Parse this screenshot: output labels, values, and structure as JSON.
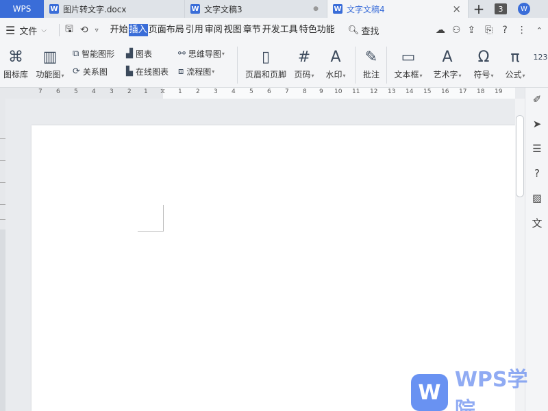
{
  "tabs": {
    "home": "WPS",
    "items": [
      {
        "title": "图片转文字.docx",
        "close": "×"
      },
      {
        "title": "文字文稿3",
        "close": "●"
      },
      {
        "title": "文字文稿4",
        "close": "×"
      }
    ],
    "count": "3"
  },
  "menubar": {
    "file": "文件",
    "tabs": [
      "开始",
      "插入",
      "页面布局",
      "引用",
      "审阅",
      "视图",
      "章节",
      "开发工具",
      "特色功能"
    ],
    "active_tab": "插入",
    "search": "查找"
  },
  "ribbon": {
    "icon_library": "图标库",
    "function_chart": "功能图",
    "smart_shape": "智能图形",
    "chart": "图表",
    "mind_map": "思维导图",
    "relation_chart": "关系图",
    "online_chart": "在线图表",
    "flowchart": "流程图",
    "header_footer": "页眉和页脚",
    "page_number": "页码",
    "watermark": "水印",
    "comment": "批注",
    "textbox": "文本框",
    "wordart": "艺术字",
    "symbol": "符号",
    "formula": "公式"
  },
  "ruler": {
    "left_numbers": [
      "7",
      "6",
      "5",
      "4",
      "3",
      "2",
      "1"
    ],
    "right_numbers": [
      "1",
      "2",
      "3",
      "4",
      "5",
      "6",
      "7",
      "8",
      "9",
      "10",
      "11",
      "12",
      "13",
      "14",
      "15",
      "16",
      "17",
      "18",
      "19"
    ]
  },
  "watermark": {
    "text": "WPS学院"
  },
  "colors": {
    "accent": "#3a6dd8",
    "watermark": "#6b8ff0"
  }
}
